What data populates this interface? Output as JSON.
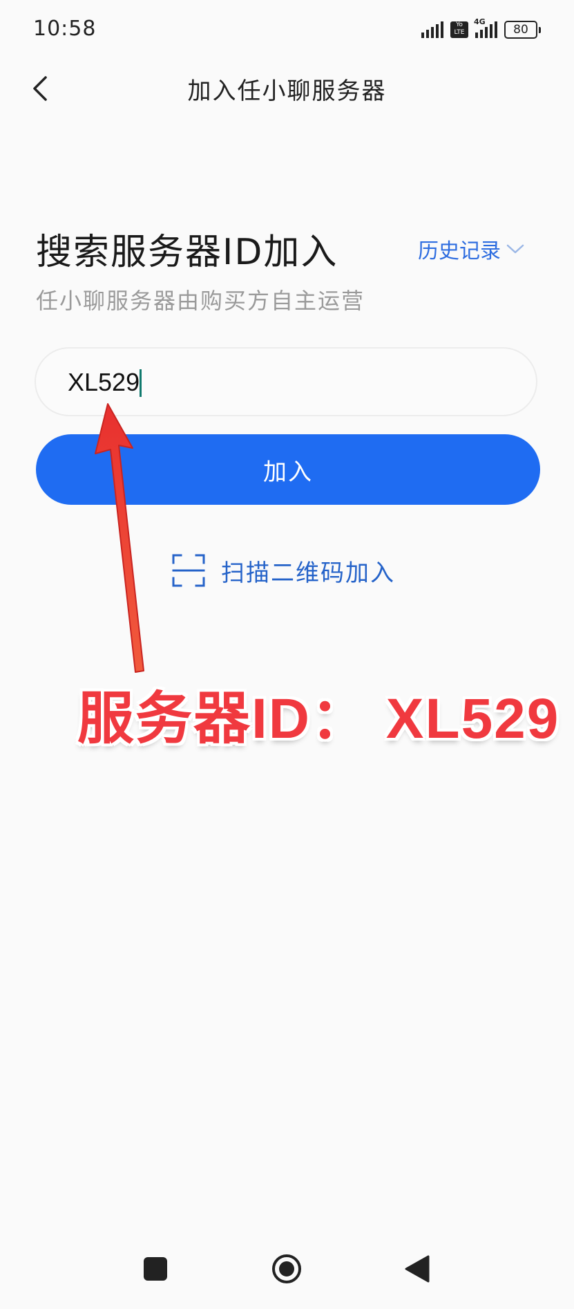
{
  "status_bar": {
    "time": "10:58",
    "volte_line1": "Yo",
    "volte_line2": "LTE",
    "network_label": "4G",
    "battery": "80"
  },
  "header": {
    "title": "加入任小聊服务器"
  },
  "main": {
    "heading": "搜索服务器ID加入",
    "history_label": "历史记录",
    "subtitle": "任小聊服务器由购买方自主运营",
    "server_input_value": "XL529",
    "join_button_label": "加入",
    "scan_label": "扫描二维码加入"
  },
  "annotation": {
    "text": "服务器ID： XL529",
    "color": "#f0393f"
  },
  "colors": {
    "accent": "#1f6cf2",
    "link": "#2e6de0"
  },
  "icons": {
    "back": "chevron-left-icon",
    "history_dropdown": "chevron-down-icon",
    "scan": "scan-frame-icon"
  }
}
